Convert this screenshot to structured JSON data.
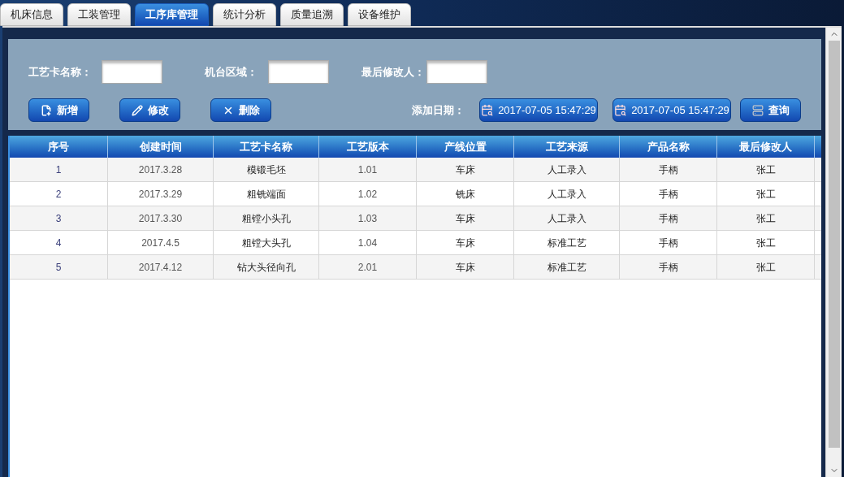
{
  "tabs": [
    {
      "label": "机床信息",
      "selected": false
    },
    {
      "label": "工装管理",
      "selected": false
    },
    {
      "label": "工序库管理",
      "selected": true
    },
    {
      "label": "统计分析",
      "selected": false
    },
    {
      "label": "质量追溯",
      "selected": false
    },
    {
      "label": "设备维护",
      "selected": false
    }
  ],
  "filters": [
    {
      "label": "工艺卡名称："
    },
    {
      "label": "机台区域："
    },
    {
      "label": "最后修改人："
    }
  ],
  "actions": [
    {
      "label": "新增",
      "kind": "add"
    },
    {
      "label": "修改",
      "kind": "edit"
    },
    {
      "label": "删除",
      "kind": "delete"
    }
  ],
  "date_filter": {
    "label": "添加日期：",
    "from": "2017-07-05 15:47:29",
    "to": "2017-07-05 15:47:29"
  },
  "query_button": "查询",
  "table": {
    "columns": [
      "序号",
      "创建时间",
      "工艺卡名称",
      "工艺版本",
      "产线位置",
      "工艺来源",
      "产品名称",
      "最后修改人"
    ],
    "rows": [
      [
        "1",
        "2017.3.28",
        "模锻毛坯",
        "1.01",
        "车床",
        "人工录入",
        "手柄",
        "张工"
      ],
      [
        "2",
        "2017.3.29",
        "粗铣端面",
        "1.02",
        "铣床",
        "人工录入",
        "手柄",
        "张工"
      ],
      [
        "3",
        "2017.3.30",
        "粗镗小头孔",
        "1.03",
        "车床",
        "人工录入",
        "手柄",
        "张工"
      ],
      [
        "4",
        "2017.4.5",
        "粗镗大头孔",
        "1.04",
        "车床",
        "标准工艺",
        "手柄",
        "张工"
      ],
      [
        "5",
        "2017.4.12",
        "钻大头径向孔",
        "2.01",
        "车床",
        "标准工艺",
        "手柄",
        "张工"
      ]
    ]
  }
}
